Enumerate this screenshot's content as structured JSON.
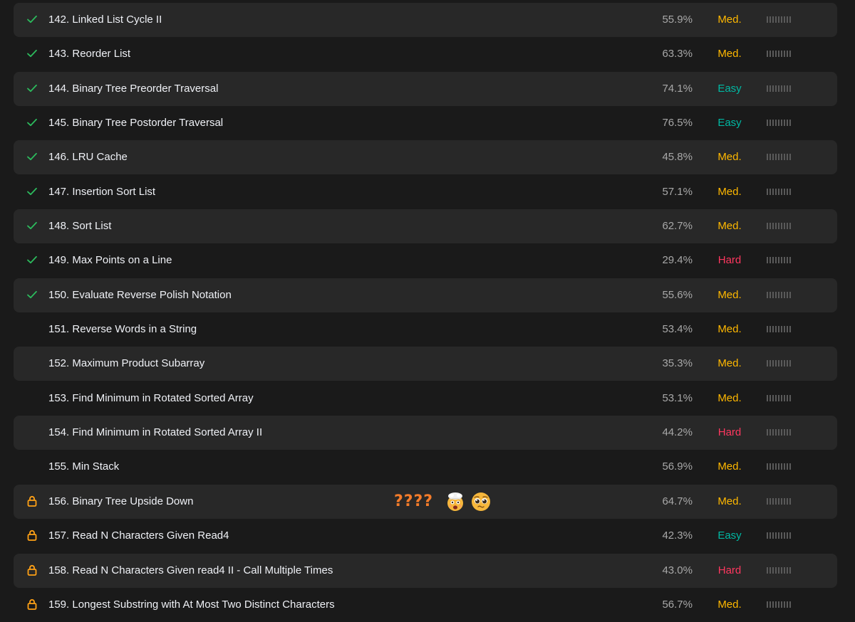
{
  "colors": {
    "background": "#1a1a1a",
    "row_striped": "#282828",
    "solved_check": "#2cbb5d",
    "lock": "#ffa116",
    "medium": "#ffb800",
    "easy": "#00b8a3",
    "hard": "#ff375f",
    "question_marks": "#f57c2a"
  },
  "problems": [
    {
      "title": "142. Linked List Cycle II",
      "acceptance": "55.9%",
      "difficulty": "Med.",
      "status": "solved"
    },
    {
      "title": "143. Reorder List",
      "acceptance": "63.3%",
      "difficulty": "Med.",
      "status": "solved"
    },
    {
      "title": "144. Binary Tree Preorder Traversal",
      "acceptance": "74.1%",
      "difficulty": "Easy",
      "status": "solved"
    },
    {
      "title": "145. Binary Tree Postorder Traversal",
      "acceptance": "76.5%",
      "difficulty": "Easy",
      "status": "solved"
    },
    {
      "title": "146. LRU Cache",
      "acceptance": "45.8%",
      "difficulty": "Med.",
      "status": "solved"
    },
    {
      "title": "147. Insertion Sort List",
      "acceptance": "57.1%",
      "difficulty": "Med.",
      "status": "solved"
    },
    {
      "title": "148. Sort List",
      "acceptance": "62.7%",
      "difficulty": "Med.",
      "status": "solved"
    },
    {
      "title": "149. Max Points on a Line",
      "acceptance": "29.4%",
      "difficulty": "Hard",
      "status": "solved"
    },
    {
      "title": "150. Evaluate Reverse Polish Notation",
      "acceptance": "55.6%",
      "difficulty": "Med.",
      "status": "solved"
    },
    {
      "title": "151. Reverse Words in a String",
      "acceptance": "53.4%",
      "difficulty": "Med.",
      "status": "none"
    },
    {
      "title": "152. Maximum Product Subarray",
      "acceptance": "35.3%",
      "difficulty": "Med.",
      "status": "none"
    },
    {
      "title": "153. Find Minimum in Rotated Sorted Array",
      "acceptance": "53.1%",
      "difficulty": "Med.",
      "status": "none"
    },
    {
      "title": "154. Find Minimum in Rotated Sorted Array II",
      "acceptance": "44.2%",
      "difficulty": "Hard",
      "status": "none"
    },
    {
      "title": "155. Min Stack",
      "acceptance": "56.9%",
      "difficulty": "Med.",
      "status": "none"
    },
    {
      "title": "156. Binary Tree Upside Down",
      "acceptance": "64.7%",
      "difficulty": "Med.",
      "status": "locked",
      "note": "????",
      "note_icons": [
        "exploding-head-emoji-icon",
        "pleading-face-emoji-icon"
      ]
    },
    {
      "title": "157. Read N Characters Given Read4",
      "acceptance": "42.3%",
      "difficulty": "Easy",
      "status": "locked"
    },
    {
      "title": "158. Read N Characters Given read4 II - Call Multiple Times",
      "acceptance": "43.0%",
      "difficulty": "Hard",
      "status": "locked"
    },
    {
      "title": "159. Longest Substring with At Most Two Distinct Characters",
      "acceptance": "56.7%",
      "difficulty": "Med.",
      "status": "locked"
    }
  ]
}
